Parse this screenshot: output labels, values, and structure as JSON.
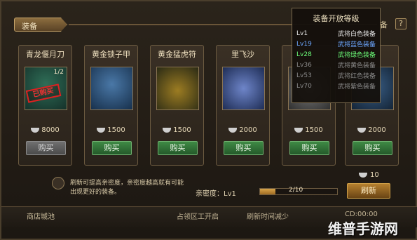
{
  "header": {
    "title": "装备",
    "right_label": "备",
    "help": "?"
  },
  "cards": [
    {
      "name": "青龙偃月刀",
      "qty": "1/2",
      "stamp": "已购买",
      "price": "8000",
      "buy": "购买",
      "disabled": true,
      "colors": [
        "#15312a",
        "#2f6e57"
      ]
    },
    {
      "name": "黄金锁子甲",
      "qty": "",
      "stamp": "",
      "price": "1500",
      "buy": "购买",
      "disabled": false,
      "colors": [
        "#17304c",
        "#4a78a7"
      ]
    },
    {
      "name": "黄金猛虎符",
      "qty": "",
      "stamp": "",
      "price": "1500",
      "buy": "购买",
      "disabled": false,
      "colors": [
        "#2a2a15",
        "#9c7c22"
      ]
    },
    {
      "name": "里飞沙",
      "qty": "",
      "stamp": "",
      "price": "2000",
      "buy": "购买",
      "disabled": false,
      "colors": [
        "#1e2d55",
        "#6e85c9"
      ]
    },
    {
      "name": "",
      "qty": "",
      "stamp": "",
      "price": "1500",
      "buy": "购买",
      "disabled": false,
      "colors": [
        "#2f2f2f",
        "#7a7a7a"
      ]
    },
    {
      "name": "",
      "qty": "",
      "stamp": "",
      "price": "2000",
      "buy": "购买",
      "disabled": false,
      "colors": [
        "#142436",
        "#3a5f87"
      ]
    }
  ],
  "popup": {
    "title": "装备开放等级",
    "rows": [
      {
        "lv": "Lv1",
        "desc": "武将白色装备",
        "color": "#e8e8e8"
      },
      {
        "lv": "Lv19",
        "desc": "武将蓝色装备",
        "color": "#6da7ff"
      },
      {
        "lv": "Lv28",
        "desc": "武将绿色装备",
        "color": "#6dff7a"
      },
      {
        "lv": "Lv36",
        "desc": "武将黄色装备",
        "color": "#8a8a8a"
      },
      {
        "lv": "Lv53",
        "desc": "武将红色装备",
        "color": "#8a8a8a"
      },
      {
        "lv": "Lv70",
        "desc": "武将紫色装备",
        "color": "#8a8a8a"
      }
    ]
  },
  "note": "刷新可提高亲密度，亲密度越高就有可能出现更好的装备。",
  "affinity": {
    "label": "亲密度：Lv1",
    "progress_text": "2/10",
    "progress": 0.2
  },
  "refresh": {
    "cost": "10",
    "label": "刷新"
  },
  "bottom": {
    "tab": "商店城池",
    "mid": "占领区工开启",
    "mid2": "刷新时间减少",
    "cd": "CD:00:00"
  },
  "watermark": "维普手游网"
}
